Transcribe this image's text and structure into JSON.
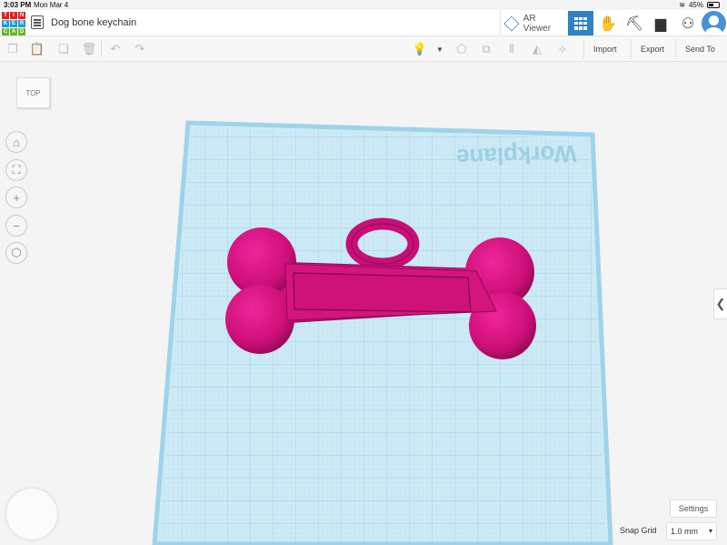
{
  "status": {
    "time": "3:03 PM",
    "date": "Mon Mar 4",
    "battery": "45%"
  },
  "header": {
    "logo_letters": [
      "T",
      "I",
      "N",
      "K",
      "E",
      "R",
      "C",
      "A",
      "D"
    ],
    "logo_colors": [
      "#e2231a",
      "#e2231a",
      "#e2231a",
      "#1f9ad6",
      "#1f9ad6",
      "#1f9ad6",
      "#69b42e",
      "#69b42e",
      "#69b42e"
    ],
    "doc_title": "Dog bone keychain",
    "ar_label": "AR Viewer"
  },
  "toolbar": {
    "import": "Import",
    "export": "Export",
    "send_to": "Send To"
  },
  "viewcube_face": "TOP",
  "workplane_label": "Workplane",
  "colors": {
    "accent": "#2f83c7",
    "shape": "#d5147f",
    "workplane": "#cdeaf5",
    "grid": "#a8d6ea"
  },
  "bottom": {
    "settings": "Settings",
    "snap_label": "Snap Grid",
    "snap_value": "1.0 mm"
  }
}
